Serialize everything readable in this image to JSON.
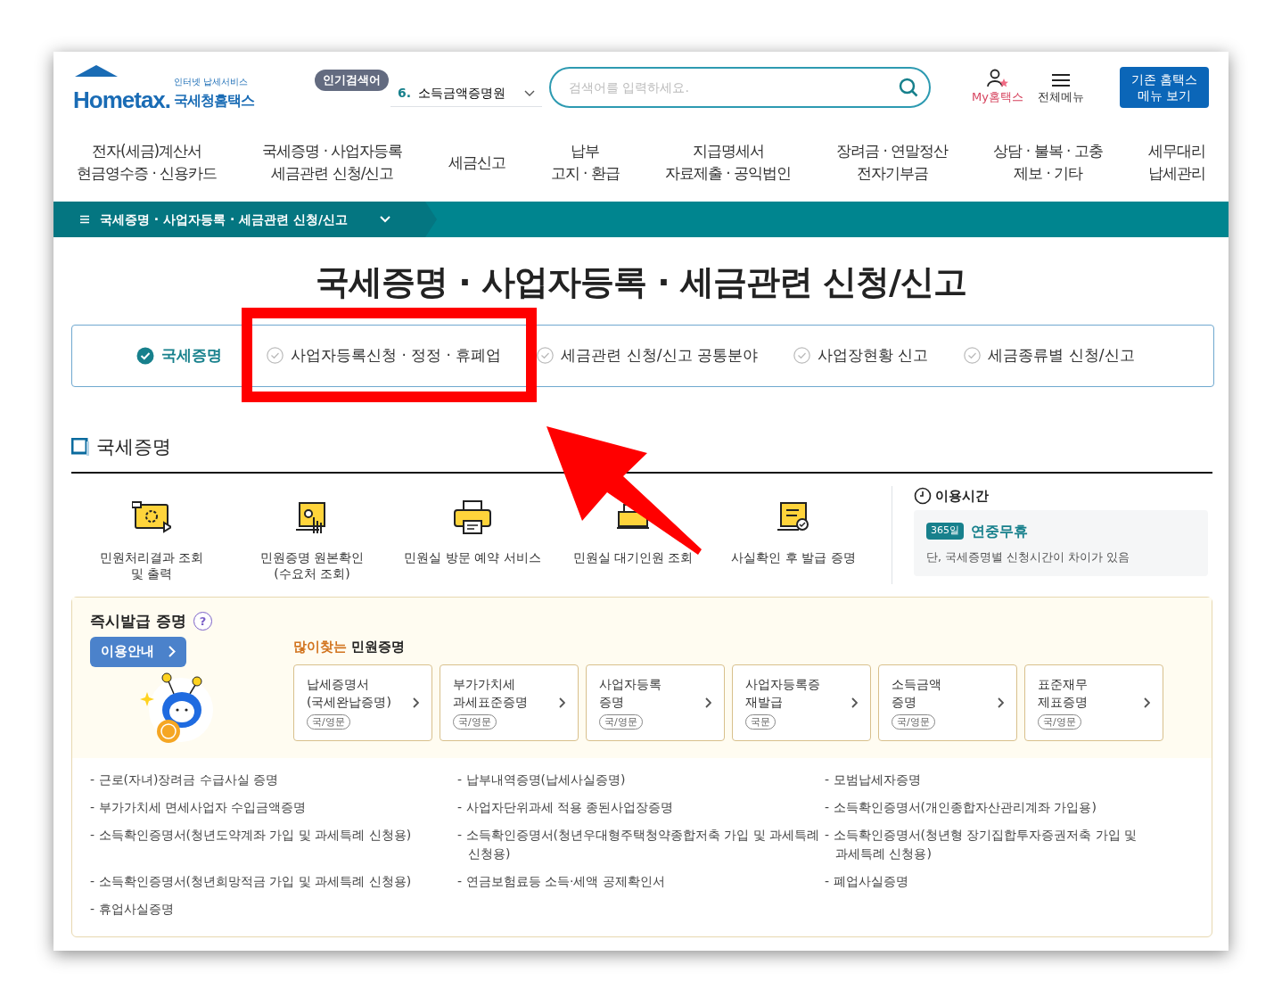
{
  "logo": {
    "tagline": "인터넷 납세서비스",
    "wordmark": "Hometax.",
    "name": "국세청홈택스"
  },
  "popular_search": {
    "label": "인기검색어",
    "rank": "6.",
    "term": "소득금액증명원"
  },
  "search": {
    "placeholder": "검색어를 입력하세요."
  },
  "header_links": [
    {
      "label": "My홈택스",
      "kind": "my"
    },
    {
      "label": "전체메뉴",
      "kind": "menu"
    }
  ],
  "legacy_button": {
    "lines": [
      "기존 홈택스",
      "메뉴 보기"
    ]
  },
  "main_nav": [
    {
      "lines": [
        "전자(세금)계산서",
        "현금영수증 · 신용카드"
      ]
    },
    {
      "lines": [
        "국세증명 · 사업자등록",
        "세금관련 신청/신고"
      ]
    },
    {
      "lines": [
        "세금신고"
      ]
    },
    {
      "lines": [
        "납부",
        "고지 · 환급"
      ]
    },
    {
      "lines": [
        "지급명세서",
        "자료제출 · 공익법인"
      ]
    },
    {
      "lines": [
        "장려금 · 연말정산",
        "전자기부금"
      ]
    },
    {
      "lines": [
        "상담 · 불복 · 고충",
        "제보 · 기타"
      ]
    },
    {
      "lines": [
        "세무대리",
        "납세관리"
      ]
    }
  ],
  "breadcrumb": {
    "label": "국세증명 · 사업자등록 · 세금관련 신청/신고"
  },
  "page_title": "국세증명 · 사업자등록 · 세금관련 신청/신고",
  "tabs": [
    {
      "label": "국세증명",
      "selected": true,
      "highlighted": false
    },
    {
      "label": "사업자등록신청 · 정정 · 휴폐업",
      "selected": false,
      "highlighted": true
    },
    {
      "label": "세금관련 신청/신고 공통분야",
      "selected": false,
      "highlighted": false
    },
    {
      "label": "사업장현황 신고",
      "selected": false,
      "highlighted": false
    },
    {
      "label": "세금종류별 신청/신고",
      "selected": false,
      "highlighted": false
    }
  ],
  "section": {
    "title": "국세증명",
    "services": [
      {
        "kind": "result",
        "lines": [
          "민원처리결과 조회",
          "및 출력"
        ]
      },
      {
        "kind": "verify",
        "lines": [
          "민원증명 원본확인",
          "(수요처 조회)"
        ]
      },
      {
        "kind": "print",
        "lines": [
          "민원실 방문 예약 서비스"
        ]
      },
      {
        "kind": "wait",
        "lines": [
          "민원실 대기인원 조회"
        ]
      },
      {
        "kind": "cert",
        "lines": [
          "사실확인 후 발급 증명"
        ]
      }
    ],
    "hours": {
      "title": "이용시간",
      "badge": "365일",
      "headline": "연중무휴",
      "note": "단, 국세증명별 신청시간이 차이가 있음"
    }
  },
  "instant": {
    "title": "즉시발급 증명",
    "help_icon": "?",
    "guide_button": "이용안내",
    "popular_prefix": "많이찾는",
    "popular_title": "민원증명",
    "cards": [
      {
        "lines": [
          "납세증명서",
          "(국세완납증명)"
        ],
        "tag": "국/영문"
      },
      {
        "lines": [
          "부가가치세",
          "과세표준증명"
        ],
        "tag": "국/영문"
      },
      {
        "lines": [
          "사업자등록",
          "증명"
        ],
        "tag": "국/영문"
      },
      {
        "lines": [
          "사업자등록증",
          "재발급"
        ],
        "tag": "국문"
      },
      {
        "lines": [
          "소득금액",
          "증명"
        ],
        "tag": "국/영문"
      },
      {
        "lines": [
          "표준재무",
          "제표증명"
        ],
        "tag": "국/영문"
      }
    ],
    "list": [
      "- 근로(자녀)장려금 수급사실 증명",
      "- 납부내역증명(납세사실증명)",
      "- 모범납세자증명",
      "- 부가가치세 면세사업자 수입금액증명",
      "- 사업자단위과세 적용 종된사업장증명",
      "- 소득확인증명서(개인종합자산관리계좌 가입용)",
      "- 소득확인증명서(청년도약계좌 가입 및 과세특례 신청용)",
      "- 소득확인증명서(청년우대형주택청약종합저축 가입 및 과세특례 신청용)",
      "- 소득확인증명서(청년형 장기집합투자증권저축 가입 및 과세특례 신청용)",
      "- 소득확인증명서(청년희망적금 가입 및 과세특례 신청용)",
      "- 연금보험료등 소득·세액 공제확인서",
      "- 폐업사실증명",
      "- 휴업사실증명"
    ]
  }
}
